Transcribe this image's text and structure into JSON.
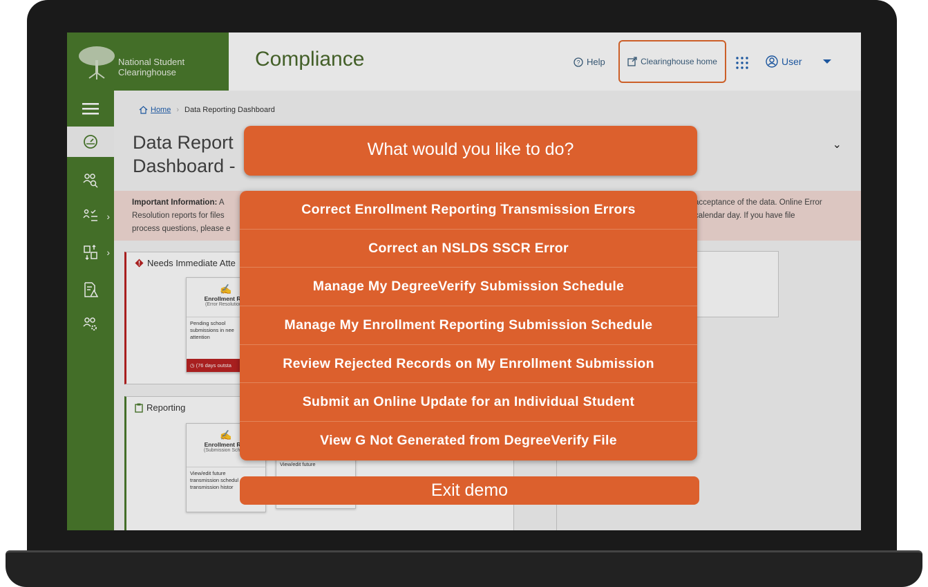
{
  "app": {
    "org_name_line1": "National Student",
    "org_name_line2": "Clearinghouse",
    "title": "Compliance"
  },
  "header": {
    "help_label": "Help",
    "clearinghouse_home_label": "Clearinghouse home",
    "user_label": "User"
  },
  "breadcrumb": {
    "home": "Home",
    "current": "Data Reporting Dashboard"
  },
  "page": {
    "title_line1": "Data Report",
    "title_line2": "Dashboard -"
  },
  "info_banner": {
    "label": "Important Information:",
    "text_left": "A",
    "line2_left": "Resolution reports for files",
    "line3_left": "process questions, please e",
    "line1_right": "acceptance of the data. Online Error",
    "line2_right": "calendar day. If you have file"
  },
  "sections": {
    "needs_attention_title": "Needs Immediate Atte",
    "reporting_title": "Reporting"
  },
  "cards": {
    "error_card": {
      "title": "Enrollment Rep",
      "subtitle": "(Error Resolution R",
      "body_line1": "Pending school",
      "body_line2": "submissions in nee",
      "body_line3": "attention",
      "footer": "(76 days outsta"
    },
    "schedule_card": {
      "title": "Enrollment Rep",
      "subtitle": "(Submission Schedu",
      "body_line1": "View/edit future",
      "body_line2": "transmission schedul",
      "body_line3": "transmission histor"
    },
    "second_card": {
      "body_line1": "View/edit future"
    }
  },
  "overlay": {
    "prompt": "What would you like to do?",
    "options": [
      "Correct Enrollment Reporting Transmission Errors",
      "Correct an NSLDS SSCR Error",
      "Manage My DegreeVerify Submission Schedule",
      "Manage My Enrollment Reporting Submission Schedule",
      "Review Rejected Records on My Enrollment Submission",
      "Submit an Online Update for an Individual Student",
      "View G Not Generated from DegreeVerify File"
    ],
    "exit_label": "Exit demo"
  },
  "colors": {
    "overlay_orange": "#dc602d",
    "brand_green": "#4a7a2c",
    "highlight_border": "#e36a2c"
  }
}
